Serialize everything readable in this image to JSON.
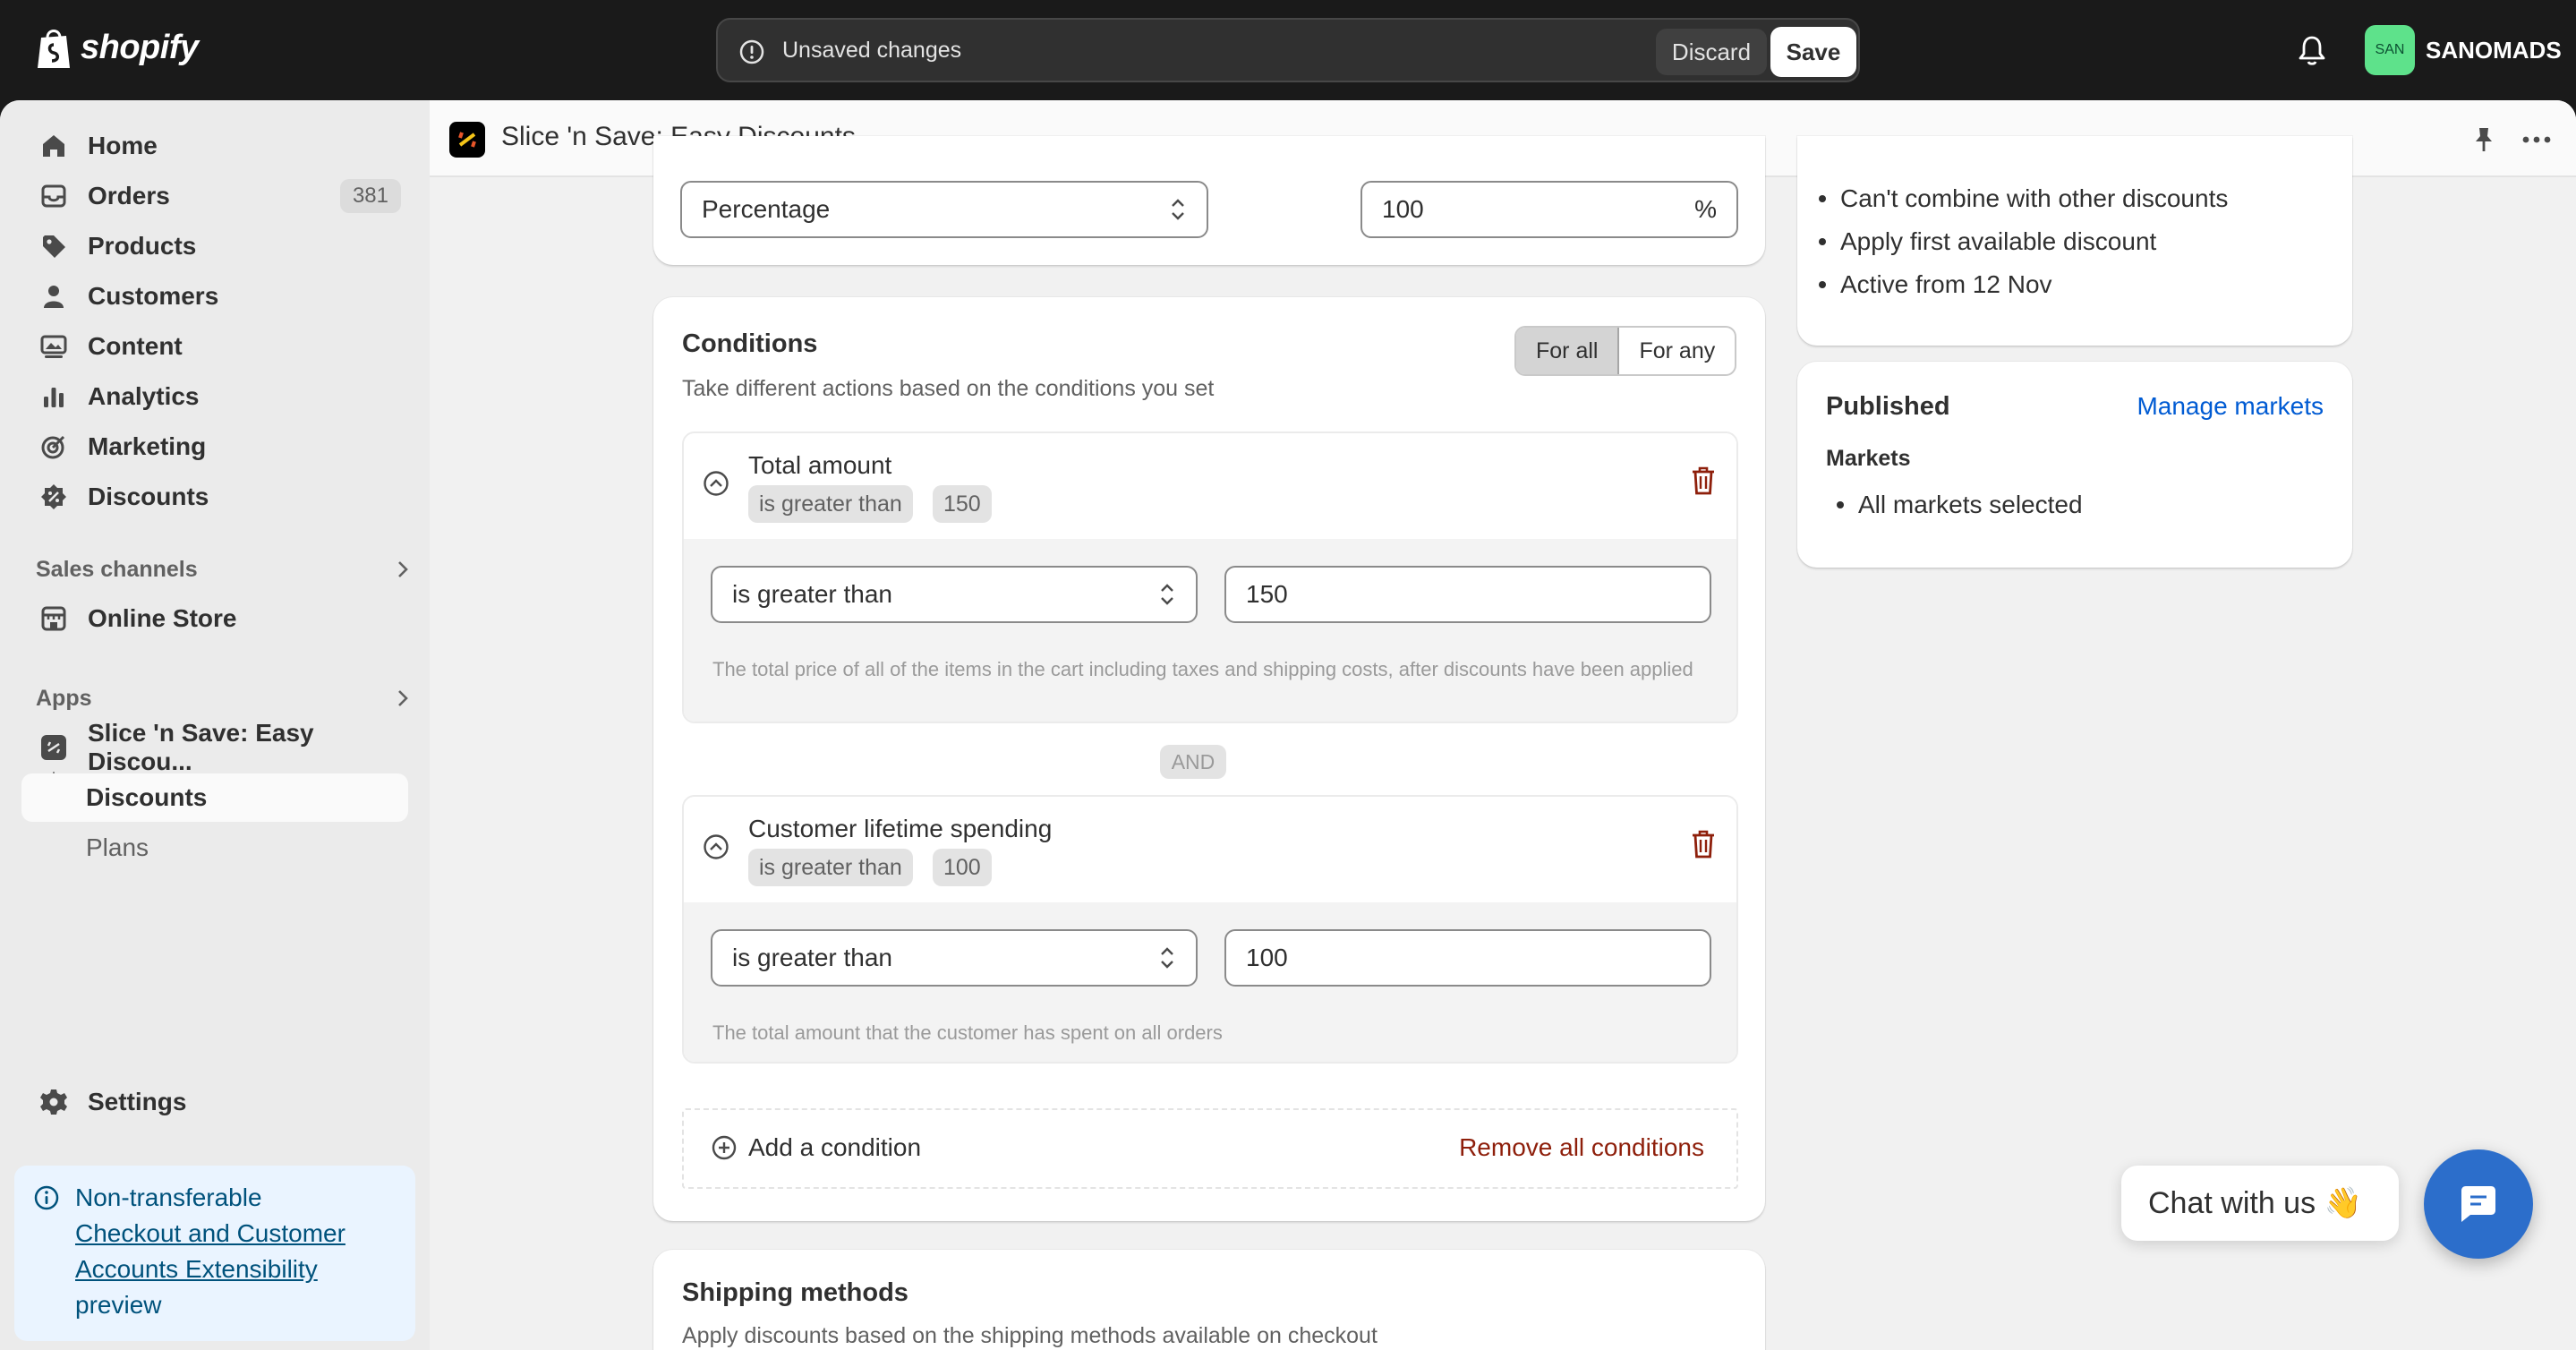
{
  "topbar": {
    "brand": "shopify",
    "unsaved_label": "Unsaved changes",
    "discard_label": "Discard",
    "save_label": "Save",
    "avatar_initials": "SAN",
    "store_name": "SANOMADS"
  },
  "sidebar": {
    "items": [
      {
        "label": "Home",
        "icon": "home-icon"
      },
      {
        "label": "Orders",
        "icon": "orders-icon",
        "badge": "381"
      },
      {
        "label": "Products",
        "icon": "tag-icon"
      },
      {
        "label": "Customers",
        "icon": "person-icon"
      },
      {
        "label": "Content",
        "icon": "content-icon"
      },
      {
        "label": "Analytics",
        "icon": "analytics-icon"
      },
      {
        "label": "Marketing",
        "icon": "target-icon"
      },
      {
        "label": "Discounts",
        "icon": "discount-icon"
      }
    ],
    "sales_channels_label": "Sales channels",
    "online_store_label": "Online Store",
    "apps_label": "Apps",
    "app_name": "Slice 'n Save: Easy Discou...",
    "app_sub_discounts": "Discounts",
    "app_sub_plans": "Plans",
    "settings_label": "Settings",
    "notice": {
      "line1": "Non-transferable",
      "link": "Checkout and Customer Accounts Extensibility",
      "line3": "preview"
    }
  },
  "appbar": {
    "title": "Slice 'n Save: Easy Discounts"
  },
  "value_card": {
    "type_select": "Percentage",
    "amount": "100",
    "suffix": "%"
  },
  "conditions": {
    "title": "Conditions",
    "subtitle": "Take different actions based on the conditions you set",
    "segment": [
      "For all",
      "For any"
    ],
    "items": [
      {
        "title": "Total amount",
        "pill_op": "is greater than",
        "pill_val": "150",
        "operator": "is greater than",
        "value": "150",
        "help": "The total price of all of the items in the cart including taxes and shipping costs, after discounts have been applied"
      },
      {
        "title": "Customer lifetime spending",
        "pill_op": "is greater than",
        "pill_val": "100",
        "operator": "is greater than",
        "value": "100",
        "help": "The total amount that the customer has spent on all orders"
      }
    ],
    "and_label": "AND",
    "add_label": "Add a condition",
    "remove_all_label": "Remove all conditions"
  },
  "shipping": {
    "title": "Shipping methods",
    "subtitle": "Apply discounts based on the shipping methods available on checkout"
  },
  "summary": {
    "bullets": [
      "Can't combine with other discounts",
      "Apply first available discount",
      "Active from 12 Nov"
    ]
  },
  "published": {
    "title": "Published",
    "manage_link": "Manage markets",
    "markets_label": "Markets",
    "markets_value": "All markets selected"
  },
  "chat": {
    "label": "Chat with us 👋"
  }
}
